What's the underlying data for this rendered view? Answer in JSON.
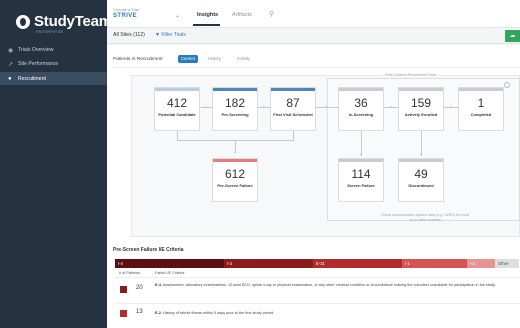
{
  "sidebar": {
    "logo_text": "StudyTeam",
    "logo_sub": "ENTERPRISE",
    "items": [
      {
        "label": "Trials Overview",
        "icon": "bullseye-icon"
      },
      {
        "label": "Site Performance",
        "icon": "trend-line-icon"
      },
      {
        "label": "Recruitment",
        "icon": "person-icon"
      }
    ]
  },
  "topbar": {
    "trial_label": "Choose a Trial",
    "trial_name": "STRIVE",
    "tabs": [
      "Insights",
      "Artifacts"
    ]
  },
  "filter": {
    "sites": "All Sites (112)",
    "filter_link": "Filter Trials"
  },
  "recruitment": {
    "header": "Patients in Recruitment",
    "pills": [
      "Current",
      "History",
      "Activity"
    ],
    "post_consent_label": "Post-Consent Recruitment Data",
    "boxes": [
      {
        "num": "412",
        "label": "Potential Candidate"
      },
      {
        "num": "182",
        "label": "Pre-Screening"
      },
      {
        "num": "87",
        "label": "First Visit Scheduled"
      },
      {
        "num": "36",
        "label": "In-Screening"
      },
      {
        "num": "159",
        "label": "Actively Enrolled"
      },
      {
        "num": "1",
        "label": "Completed"
      },
      {
        "num": "612",
        "label": "Pre-Screen Failure"
      },
      {
        "num": "114",
        "label": "Screen Failure"
      },
      {
        "num": "49",
        "label": "Discontinued"
      }
    ],
    "footnote": "Check randomization system data (e.g. IWRS) for most up-to-date numbers"
  },
  "prescreen": {
    "title": "Pre-Screen Failure I/E Criteria",
    "segments": [
      {
        "label": "I-4",
        "color": "#5c0f0f",
        "share": 0.27
      },
      {
        "label": "I-3",
        "color": "#8b1c1c",
        "share": 0.22
      },
      {
        "label": "E-31",
        "color": "#b32b2b",
        "share": 0.22
      },
      {
        "label": "I-1",
        "color": "#d45454",
        "share": 0.16
      },
      {
        "label": "I-2",
        "color": "#e89393",
        "share": 0.07
      },
      {
        "label": "Other",
        "color": "#dcdfe2",
        "share": 0.06
      }
    ],
    "col_patients": "# of Patients",
    "col_criteria": "Failed I/E Criteria",
    "rows": [
      {
        "count": "20",
        "code": "E-4.",
        "text": "Assessment, laboratory examinations, 12-lead ECG, spinal x-ray or physical examination, or any other medical condition or circumstance making the volunteer unsuitable for participation in the study.",
        "color": "#8b1c1c"
      },
      {
        "count": "13",
        "code": "E-2.",
        "text": "History of febrile illness within 5 days prior to the first study period",
        "color": "#b32b2b"
      }
    ]
  }
}
